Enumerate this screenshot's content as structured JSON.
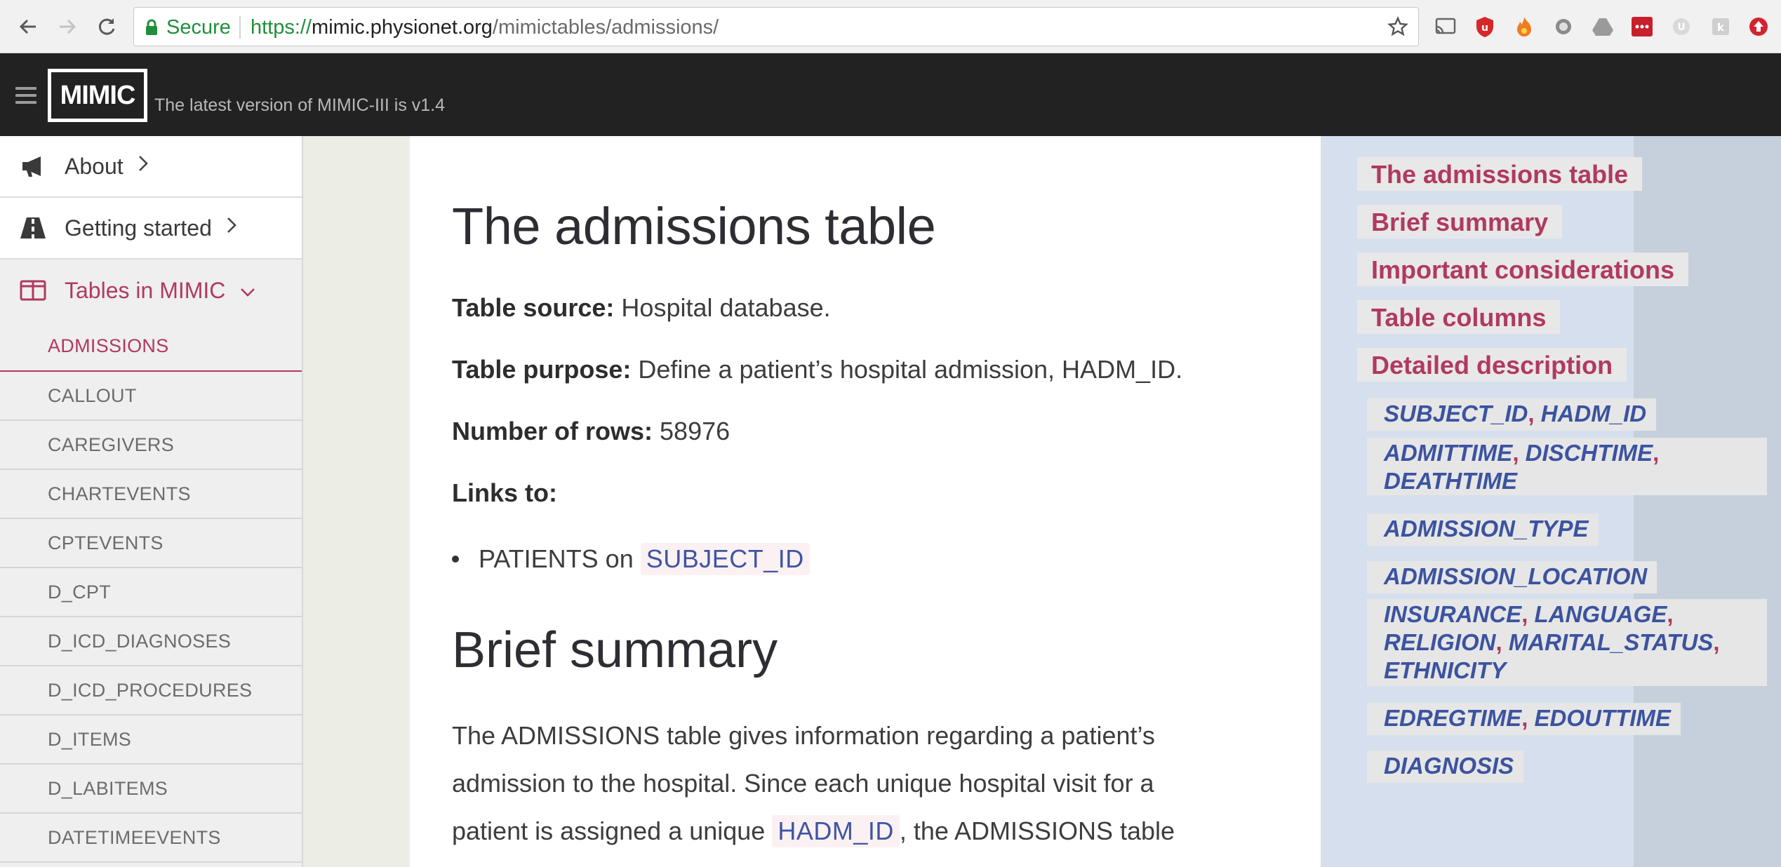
{
  "browser": {
    "secure_label": "Secure",
    "url_scheme": "https://",
    "url_host": "mimic.physionet.org",
    "url_path": "/mimictables/admissions/"
  },
  "header": {
    "logo": "MIMIC",
    "tagline": "The latest version of MIMIC-III is v1.4"
  },
  "sidebar": {
    "about": "About",
    "getting_started": "Getting started",
    "tables": "Tables in MIMIC",
    "items": [
      "ADMISSIONS",
      "CALLOUT",
      "CAREGIVERS",
      "CHARTEVENTS",
      "CPTEVENTS",
      "D_CPT",
      "D_ICD_DIAGNOSES",
      "D_ICD_PROCEDURES",
      "D_ITEMS",
      "D_LABITEMS",
      "DATETIMEEVENTS"
    ],
    "active": "ADMISSIONS"
  },
  "main": {
    "title": "The admissions table",
    "source_label": "Table source:",
    "source_value": "Hospital database.",
    "purpose_label": "Table purpose:",
    "purpose_value": "Define a patient’s hospital admission, HADM_ID.",
    "rows_label": "Number of rows:",
    "rows_value": "58976",
    "links_label": "Links to:",
    "link_text": "PATIENTS on",
    "link_code": "SUBJECT_ID",
    "summary_title": "Brief summary",
    "summary_line1": "The ADMISSIONS table gives information regarding a patient’s",
    "summary_line2": "admission to the hospital. Since each unique hospital visit for a",
    "summary_line3_pre": "patient is assigned a unique",
    "summary_line3_code": "HADM_ID",
    "summary_line3_post": ", the ADMISSIONS table"
  },
  "toc": {
    "headings": [
      "The admissions table",
      "Brief summary",
      "Important considerations",
      "Table columns",
      "Detailed description"
    ],
    "subs": {
      "s1a": "SUBJECT_ID",
      "s1b": "HADM_ID",
      "s2a": "ADMITTIME",
      "s2b": "DISCHTIME",
      "s2c": "DEATHTIME",
      "s3": "ADMISSION_TYPE",
      "s4": "ADMISSION_LOCATION",
      "s5a": "INSURANCE",
      "s5b": "LANGUAGE",
      "s5c": "RELIGION",
      "s5d": "MARITAL_STATUS",
      "s5e": "ETHNICITY",
      "s6a": "EDREGTIME",
      "s6b": "EDOUTTIME",
      "s7": "DIAGNOSIS",
      "comma": ","
    }
  },
  "colors": {
    "accent": "#b03a5e",
    "link_blue": "#3b53a0",
    "header_bg": "#222222"
  }
}
